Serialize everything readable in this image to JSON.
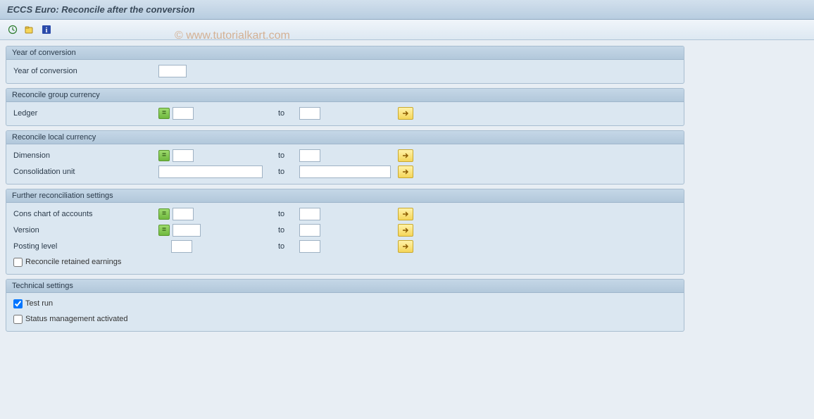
{
  "title": "ECCS Euro: Reconcile after the conversion",
  "watermark": "© www.tutorialkart.com",
  "toolbar": {
    "execute": "execute",
    "variant": "variant",
    "info": "info"
  },
  "groups": {
    "year_conv": {
      "header": "Year of conversion",
      "rows": {
        "year": {
          "label": "Year of conversion",
          "value": ""
        }
      }
    },
    "group_currency": {
      "header": "Reconcile group currency",
      "rows": {
        "ledger": {
          "label": "Ledger",
          "from": "",
          "to_label": "to",
          "to": ""
        }
      }
    },
    "local_currency": {
      "header": "Reconcile local currency",
      "rows": {
        "dimension": {
          "label": "Dimension",
          "from": "",
          "to_label": "to",
          "to": ""
        },
        "cons_unit": {
          "label": "Consolidation unit",
          "from": "",
          "to_label": "to",
          "to": ""
        }
      }
    },
    "further": {
      "header": "Further reconciliation settings",
      "rows": {
        "chart": {
          "label": "Cons chart of accounts",
          "from": "",
          "to_label": "to",
          "to": ""
        },
        "version": {
          "label": "Version",
          "from": "",
          "to_label": "to",
          "to": ""
        },
        "posting": {
          "label": "Posting level",
          "from": "",
          "to_label": "to",
          "to": ""
        }
      },
      "checkbox": {
        "label": "Reconcile retained earnings",
        "checked": false
      }
    },
    "technical": {
      "header": "Technical settings",
      "checkboxes": {
        "test_run": {
          "label": "Test run",
          "checked": true
        },
        "status_mgmt": {
          "label": "Status management activated",
          "checked": false
        }
      }
    }
  }
}
